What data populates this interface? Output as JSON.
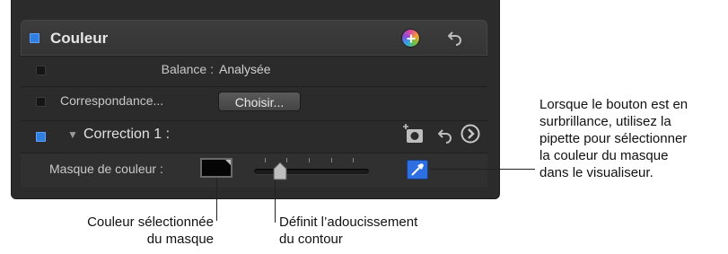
{
  "panel": {
    "header_title": "Couleur",
    "balance": {
      "label": "Balance :",
      "value": "Analysée"
    },
    "match": {
      "label": "Correspondance...",
      "button": "Choisir..."
    },
    "correction": {
      "disclosure": "▼",
      "title": "Correction 1 :"
    },
    "mask": {
      "label": "Masque de couleur :"
    }
  },
  "icons": {
    "add": "add-circle-icon",
    "reset": "reset-arrow-icon",
    "shape_mask": "shape-mask-icon",
    "navigate": "chevron-right-circle-icon",
    "eyedropper": "eyedropper-icon"
  },
  "colors": {
    "accent_blue": "#2f7fe0",
    "panel_bg": "#2b2b2b"
  },
  "callouts": {
    "right_lines": [
      "Lorsque le bouton est en",
      "surbrillance, utilisez la",
      "pipette pour sélectionner",
      "la couleur du masque",
      "dans le visualiseur."
    ],
    "left_lines": [
      "Couleur sélectionnée",
      "du masque"
    ],
    "middle_lines": [
      "Définit l’adoucissement",
      "du contour"
    ]
  }
}
